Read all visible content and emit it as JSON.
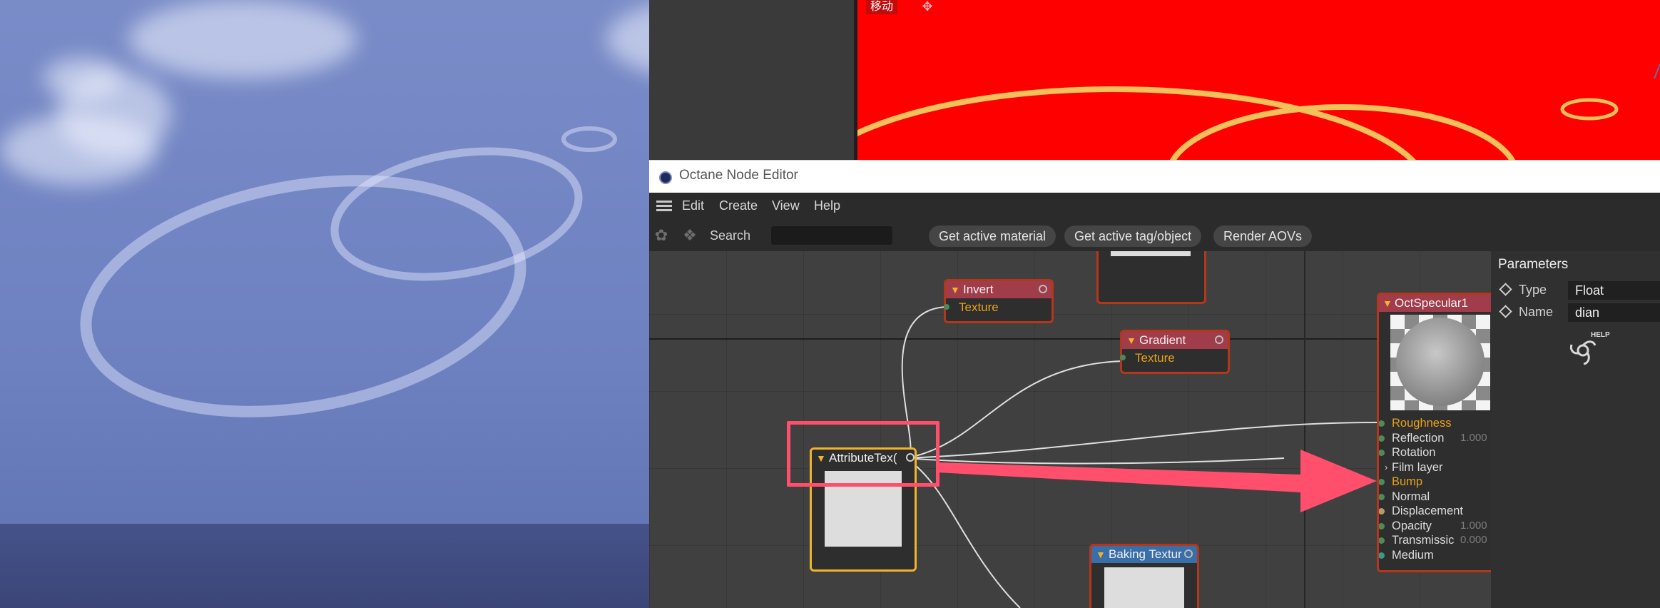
{
  "viewport_tag": "移动",
  "window_title": "Octane Node Editor",
  "menu": [
    "Edit",
    "Create",
    "View",
    "Help"
  ],
  "toolbar": {
    "search_label": "Search",
    "search_value": "",
    "buttons": [
      "Get active material",
      "Get active tag/object",
      "Render AOVs"
    ]
  },
  "nodes": {
    "invert": {
      "title": "Invert",
      "pin": "Texture"
    },
    "gradient": {
      "title": "Gradient",
      "pin": "Texture"
    },
    "attribute": {
      "title": "AttributeTex("
    },
    "baking": {
      "title": "Baking Textur"
    }
  },
  "specular": {
    "title": "OctSpecular1",
    "pins": [
      {
        "label": "Roughness",
        "value": "",
        "highlight": true
      },
      {
        "label": "Reflection",
        "value": "1.000",
        "highlight": false
      },
      {
        "label": "Rotation",
        "value": "",
        "highlight": false
      },
      {
        "label": "Film layer",
        "value": "",
        "highlight": false
      },
      {
        "label": "Bump",
        "value": "",
        "highlight": true
      },
      {
        "label": "Normal",
        "value": "",
        "highlight": false
      },
      {
        "label": "Displacement",
        "value": "",
        "highlight": false
      },
      {
        "label": "Opacity",
        "value": "1.000",
        "highlight": false
      },
      {
        "label": "Transmissic",
        "value": "0.000",
        "highlight": false
      },
      {
        "label": "Medium",
        "value": "",
        "highlight": false
      }
    ]
  },
  "parameters": {
    "title": "Parameters",
    "type_label": "Type",
    "type_value": "Float",
    "name_label": "Name",
    "name_value": "dian",
    "help_label": "HELP"
  },
  "colors": {
    "node_border": "#b5371b",
    "node_header": "#a13c4a",
    "pin_highlight": "#e6a11b",
    "annotation": "#ff4f6c",
    "viewport_red": "#ff0000"
  }
}
